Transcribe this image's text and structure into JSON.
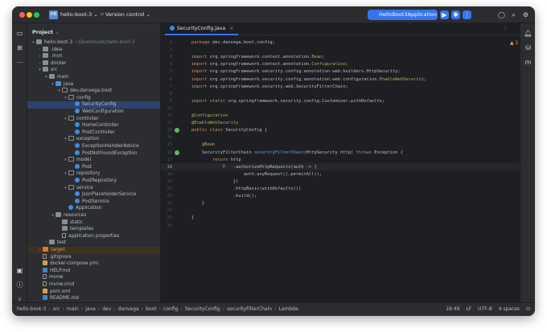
{
  "window": {
    "project_name": "hello-boot-3",
    "project_badge": "HB",
    "vcs": "Version control",
    "run_config": "HelloBoot3Application"
  },
  "project_panel": {
    "title": "Project",
    "rows": [
      {
        "indent": 0,
        "arrow": "▾",
        "icon": "folder",
        "label": "hello-boot-3",
        "extra": "~/Downloads/hello-boot-3"
      },
      {
        "indent": 1,
        "arrow": "›",
        "icon": "folder",
        "label": ".idea"
      },
      {
        "indent": 1,
        "arrow": "›",
        "icon": "folder",
        "label": ".mvn"
      },
      {
        "indent": 1,
        "arrow": "›",
        "icon": "folder",
        "label": "docker"
      },
      {
        "indent": 1,
        "arrow": "▾",
        "icon": "folder",
        "label": "src"
      },
      {
        "indent": 2,
        "arrow": "▾",
        "icon": "folder",
        "label": "main"
      },
      {
        "indent": 3,
        "arrow": "▾",
        "icon": "src",
        "label": "java"
      },
      {
        "indent": 4,
        "arrow": "▾",
        "icon": "pkg",
        "label": "dev.danvega.boot"
      },
      {
        "indent": 5,
        "arrow": "▾",
        "icon": "pkg",
        "label": "config"
      },
      {
        "indent": 6,
        "arrow": "",
        "icon": "class",
        "label": "SecurityConfig",
        "selected": true
      },
      {
        "indent": 6,
        "arrow": "",
        "icon": "class",
        "label": "WebConfiguration"
      },
      {
        "indent": 5,
        "arrow": "▾",
        "icon": "pkg",
        "label": "controller"
      },
      {
        "indent": 6,
        "arrow": "",
        "icon": "class",
        "label": "HomeController"
      },
      {
        "indent": 6,
        "arrow": "",
        "icon": "class",
        "label": "PostController"
      },
      {
        "indent": 5,
        "arrow": "▾",
        "icon": "pkg",
        "label": "exception"
      },
      {
        "indent": 6,
        "arrow": "",
        "icon": "class",
        "label": "ExceptionHandlerAdvice"
      },
      {
        "indent": 6,
        "arrow": "",
        "icon": "class",
        "label": "PostNotFoundException"
      },
      {
        "indent": 5,
        "arrow": "▾",
        "icon": "pkg",
        "label": "model"
      },
      {
        "indent": 6,
        "arrow": "",
        "icon": "class",
        "label": "Post"
      },
      {
        "indent": 5,
        "arrow": "▾",
        "icon": "pkg",
        "label": "repository"
      },
      {
        "indent": 6,
        "arrow": "",
        "icon": "class",
        "label": "PostRepository"
      },
      {
        "indent": 5,
        "arrow": "▾",
        "icon": "pkg",
        "label": "service"
      },
      {
        "indent": 6,
        "arrow": "",
        "icon": "class",
        "label": "JsonPlaceholderService"
      },
      {
        "indent": 6,
        "arrow": "",
        "icon": "class",
        "label": "PostService"
      },
      {
        "indent": 5,
        "arrow": "",
        "icon": "class",
        "label": "Application"
      },
      {
        "indent": 3,
        "arrow": "▾",
        "icon": "folder",
        "label": "resources"
      },
      {
        "indent": 4,
        "arrow": "",
        "icon": "folder",
        "label": "static"
      },
      {
        "indent": 4,
        "arrow": "",
        "icon": "folder",
        "label": "templates"
      },
      {
        "indent": 4,
        "arrow": "",
        "icon": "file",
        "label": "application.properties"
      },
      {
        "indent": 2,
        "arrow": "›",
        "icon": "folder",
        "label": "test"
      },
      {
        "indent": 1,
        "arrow": "›",
        "icon": "excl",
        "label": "target",
        "target": true
      },
      {
        "indent": 1,
        "arrow": "",
        "icon": "file",
        "label": ".gitignore"
      },
      {
        "indent": 1,
        "arrow": "",
        "icon": "xml",
        "label": "docker-compose.yml"
      },
      {
        "indent": 1,
        "arrow": "",
        "icon": "md",
        "label": "HELP.md"
      },
      {
        "indent": 1,
        "arrow": "",
        "icon": "file",
        "label": "mvnw"
      },
      {
        "indent": 1,
        "arrow": "",
        "icon": "file",
        "label": "mvnw.cmd"
      },
      {
        "indent": 1,
        "arrow": "",
        "icon": "xml",
        "label": "pom.xml"
      },
      {
        "indent": 1,
        "arrow": "",
        "icon": "md",
        "label": "README.md"
      },
      {
        "indent": 0,
        "arrow": "›",
        "icon": "folder",
        "label": "External Libraries"
      },
      {
        "indent": 0,
        "arrow": "›",
        "icon": "folder",
        "label": "Scratches and Consoles"
      }
    ]
  },
  "editor": {
    "tab": "SecurityConfig.java",
    "current_line": 18,
    "lines": [
      {
        "n": "1",
        "html": "<span class='kw'>package</span> dev.danvega.boot.config;"
      },
      {
        "n": "2",
        "html": ""
      },
      {
        "n": "3",
        "html": "<span class='kw'>import</span> org.springframework.context.annotation.<span class='hl'>Bean</span>;"
      },
      {
        "n": "4",
        "html": "<span class='kw'>import</span> org.springframework.context.annotation.<span class='hl'>Configuration</span>;"
      },
      {
        "n": "5",
        "html": "<span class='kw'>import</span> org.springframework.security.config.annotation.web.builders.HttpSecurity;"
      },
      {
        "n": "6",
        "html": "<span class='kw'>import</span> org.springframework.security.config.annotation.web.configuration.<span class='hl'>EnableWebSecurity</span>;"
      },
      {
        "n": "7",
        "html": "<span class='kw'>import</span> org.springframework.security.web.SecurityFilterChain;"
      },
      {
        "n": "8",
        "html": ""
      },
      {
        "n": "9",
        "html": "<span class='kw'>import static</span> org.springframework.security.config.Customizer.<span class='it'>withDefaults</span>;"
      },
      {
        "n": "10",
        "html": ""
      },
      {
        "n": "11",
        "html": "<span class='ann'>@Configuration</span>"
      },
      {
        "n": "12",
        "html": "<span class='ann'>@EnableWebSecurity</span>"
      },
      {
        "n": "13",
        "html": "<span class='kw'>public class</span> SecurityConfig {"
      },
      {
        "n": "14",
        "html": ""
      },
      {
        "n": "15",
        "html": "    <span class='ann'>@Bean</span>"
      },
      {
        "n": "16",
        "html": "    SecurityFilterChain <span class='fn'>securityFilterChain</span>(HttpSecurity http) <span class='kw'>throws</span> Exception {"
      },
      {
        "n": "17",
        "html": "        <span class='kw'>return</span> http"
      },
      {
        "n": "18",
        "html": "                .authorizeHttpRequests(auth -&gt; {"
      },
      {
        "n": "19",
        "html": "                    auth.anyRequest().permitAll();"
      },
      {
        "n": "20",
        "html": "                })"
      },
      {
        "n": "21",
        "html": "                .httpBasic(<span class='it'>withDefaults</span>())"
      },
      {
        "n": "22",
        "html": "                .build();"
      },
      {
        "n": "23",
        "html": "    }"
      },
      {
        "n": "24",
        "html": ""
      },
      {
        "n": "25",
        "html": "}"
      },
      {
        "n": "26",
        "html": ""
      }
    ],
    "warning_count": "1"
  },
  "statusbar": {
    "crumbs": [
      "hello-boot-3",
      "src",
      "main",
      "java",
      "dev",
      "danvega",
      "boot",
      "config",
      "SecurityConfig",
      "securityFilterChain",
      "Lambda"
    ],
    "position": "18:49",
    "line_sep": "LF",
    "encoding": "UTF-8",
    "indent": "4 spaces"
  },
  "colors": {
    "accent": "#3574f0",
    "selection": "#2e436e",
    "background": "#1e1f22",
    "panel": "#2b2d30"
  }
}
